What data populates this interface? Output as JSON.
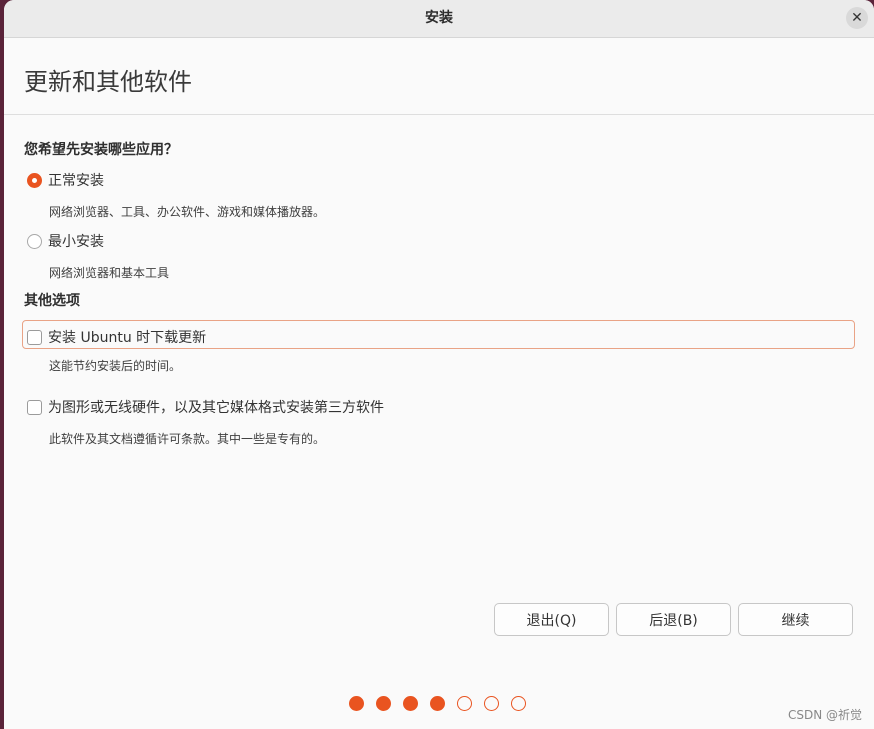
{
  "window": {
    "title": "安装",
    "close_glyph": "✕"
  },
  "page": {
    "title": "更新和其他软件"
  },
  "install_type": {
    "heading": "您希望先安装哪些应用？",
    "options": [
      {
        "label": "正常安装",
        "description": "网络浏览器、工具、办公软件、游戏和媒体播放器。",
        "selected": true
      },
      {
        "label": "最小安装",
        "description": "网络浏览器和基本工具",
        "selected": false
      }
    ]
  },
  "other_options": {
    "heading": "其他选项",
    "items": [
      {
        "label": "安装 Ubuntu 时下载更新",
        "description": "这能节约安装后的时间。",
        "checked": false,
        "focused": true
      },
      {
        "label": "为图形或无线硬件，以及其它媒体格式安装第三方软件",
        "description": "此软件及其文档遵循许可条款。其中一些是专有的。",
        "checked": false,
        "focused": false
      }
    ]
  },
  "buttons": {
    "quit": "退出(Q)",
    "back": "后退(B)",
    "continue": "继续"
  },
  "progress": {
    "total_steps": 7,
    "completed_steps": 4
  },
  "watermark": "CSDN @祈觉",
  "colors": {
    "accent": "#e95420",
    "background": "#fafafa"
  }
}
